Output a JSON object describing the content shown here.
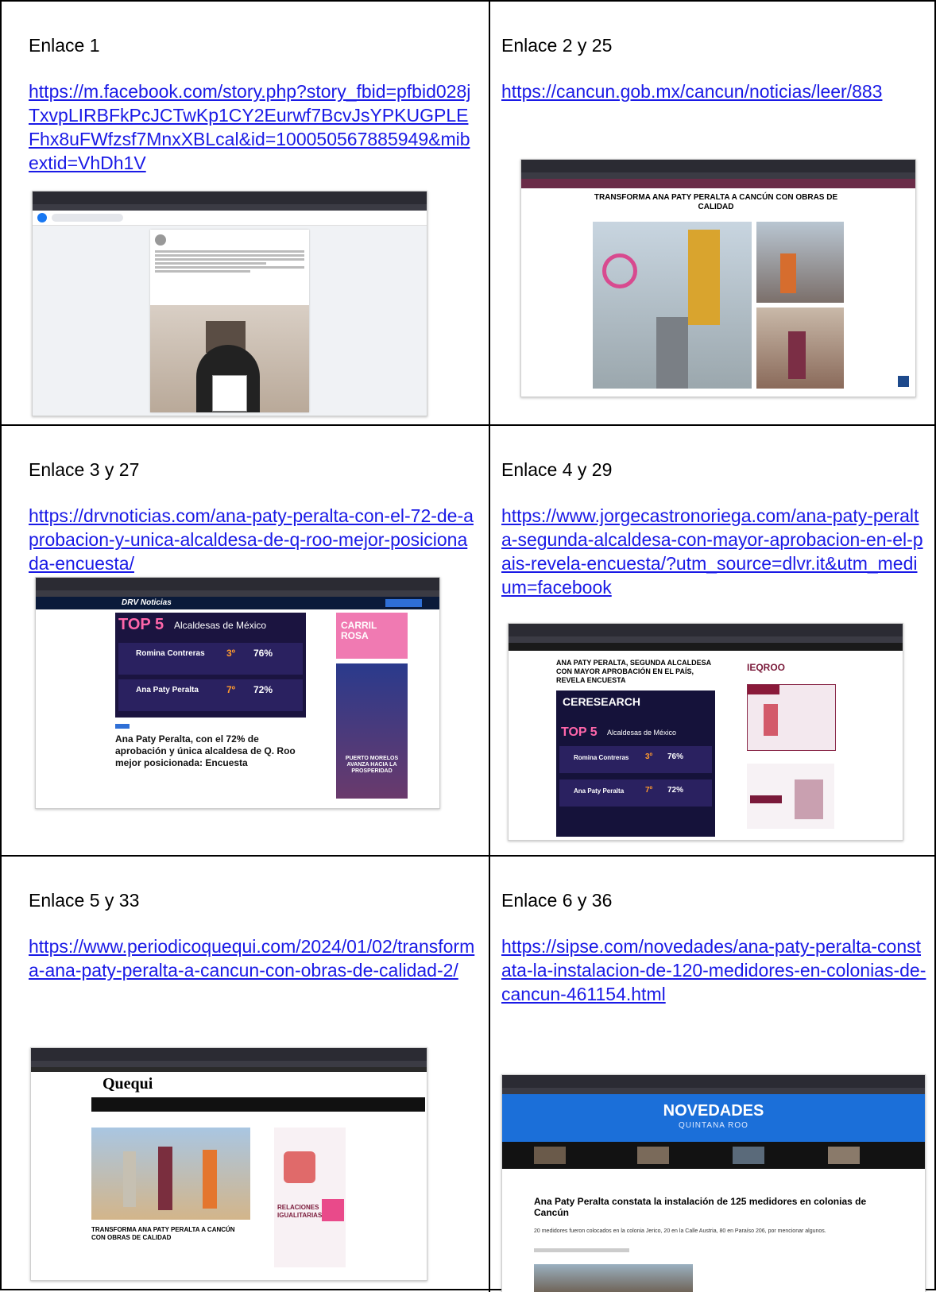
{
  "cells": [
    {
      "label": "Enlace 1",
      "url": "https://m.facebook.com/story.php?story_fbid=pfbid028jTxvpLIRBFkPcJCTwKp1CY2Eurwf7BcvJsYPKUGPLEFhx8uFWfzsf7MnxXBLcal&id=100050567885949&mibextid=VhDh1V"
    },
    {
      "label": "Enlace 2 y 25",
      "url": "https://cancun.gob.mx/cancun/noticias/leer/883",
      "shot_headline": "TRANSFORMA ANA PATY PERALTA A CANCÚN CON OBRAS DE CALIDAD"
    },
    {
      "label": "Enlace 3 y 27",
      "url": "https://drvnoticias.com/ana-paty-peralta-con-el-72-de-aprobacion-y-unica-alcaldesa-de-q-roo-mejor-posicionada-encuesta/",
      "shot_brand": "DRV Noticias",
      "shot_top": "TOP 5",
      "shot_top_sub": "Alcaldesas de México",
      "shot_row1_name": "Romina Contreras",
      "shot_row1_pos": "3º",
      "shot_row1_pct": "76%",
      "shot_row2_name": "Ana Paty Peralta",
      "shot_row2_pos": "7º",
      "shot_row2_pct": "72%",
      "shot_side1": "CARRIL ROSA",
      "shot_side2": "PUERTO MORELOS AVANZA HACIA LA PROSPERIDAD",
      "shot_headline": "Ana Paty Peralta, con el 72% de aprobación y única alcaldesa de Q. Roo mejor posicionada: Encuesta"
    },
    {
      "label": "Enlace 4 y 29",
      "url": "https://www.jorgecastronoriega.com/ana-paty-peralta-segunda-alcaldesa-con-mayor-aprobacion-en-el-pais-revela-encuesta/?utm_source=dlvr.it&utm_medium=facebook",
      "shot_headline": "ANA PATY PERALTA, SEGUNDA ALCALDESA CON MAYOR APROBACIÓN EN EL PAÍS, REVELA ENCUESTA",
      "shot_brand": "CERESEARCH",
      "shot_top": "TOP 5",
      "shot_top_sub": "Alcaldesas de México",
      "shot_side": "IEQROO",
      "shot_row1_name": "Romina Contreras",
      "shot_row1_pos": "3º",
      "shot_row1_pct": "76%",
      "shot_row2_name": "Ana Paty Peralta",
      "shot_row2_pos": "7º",
      "shot_row2_pct": "72%"
    },
    {
      "label": "Enlace 5 y 33",
      "url": "https://www.periodicoquequi.com/2024/01/02/transforma-ana-paty-peralta-a-cancun-con-obras-de-calidad-2/",
      "shot_brand": "Quequi",
      "shot_side": "RELACIONES IGUALITARIAS",
      "shot_headline": "TRANSFORMA ANA PATY PERALTA A CANCÚN CON OBRAS DE CALIDAD"
    },
    {
      "label": "Enlace 6 y 36",
      "url": "https://sipse.com/novedades/ana-paty-peralta-constata-la-instalacion-de-120-medidores-en-colonias-de-cancun-461154.html",
      "shot_brand": "NOVEDADES",
      "shot_brand_sub": "QUINTANA ROO",
      "shot_headline": "Ana Paty Peralta constata la instalación de 125 medidores en colonias de Cancún",
      "shot_sub": "20 medidores fueron colocados en la colonia Jerico, 20 en la Calle Austria, 80 en Paraíso 206, por mencionar algunos."
    }
  ],
  "colors": {
    "link": "#1a1ae6",
    "border": "#000000",
    "brand_pink": "#e0428c",
    "novedades_blue": "#1b6fd9"
  }
}
